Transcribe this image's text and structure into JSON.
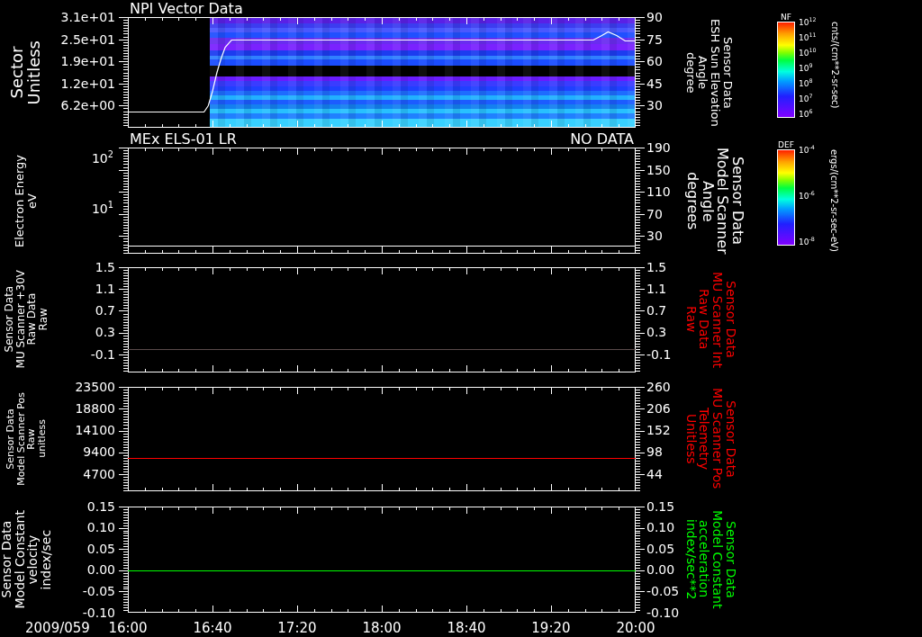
{
  "panels": [
    {
      "title": "NPI Vector Data",
      "left_label": [
        "Sector",
        "Unitless"
      ],
      "left_ticks": [
        "3.1e+01",
        "2.5e+01",
        "1.9e+01",
        "1.2e+01",
        "6.2e+00"
      ],
      "right_label": {
        "lines": [
          "Sensor Data",
          "ESH Sun Elevation",
          "Angle",
          "degree"
        ],
        "color": "#ffffff"
      },
      "spectrogram": true,
      "colorbar": {
        "title": "NF",
        "ticks": [
          "10$^{12}$",
          "10$^{11}$",
          "10$^{10}$",
          "10$^{9}$",
          "10$^{8}$",
          "10$^{7}$",
          "10$^{6}$"
        ],
        "unit": "cnts/(cm**2-sr-sec)"
      },
      "chart_data": {
        "type": "line",
        "xlim": [
          16,
          20
        ],
        "ylim": [
          15,
          90
        ],
        "yticks": [
          {
            "value": 90,
            "label": "90"
          },
          {
            "value": 75,
            "label": "75"
          },
          {
            "value": 60,
            "label": "60"
          },
          {
            "value": 45,
            "label": "45"
          },
          {
            "value": 30,
            "label": "30"
          }
        ],
        "x": [
          16,
          16.6,
          16.633,
          16.667,
          16.7,
          16.733,
          16.767,
          16.817,
          19.667,
          19.733,
          19.783,
          19.85,
          19.917,
          20
        ],
        "series": [
          {
            "color": "#ffffff",
            "values": [
              26,
              26,
              30,
              40,
              52,
              62,
              70,
              75,
              75,
              78,
              80,
              78,
              74,
              74
            ]
          }
        ]
      }
    },
    {
      "title": "MEx ELS-01 LR",
      "status": "NO DATA",
      "left_label": [
        "Electron Energy",
        "eV"
      ],
      "left_ticks": [
        "10$^{2}$",
        "10$^{1}$"
      ],
      "right_label": {
        "lines": [
          "Sensor Data",
          "Model Scanner",
          "Angle",
          "degrees"
        ],
        "color": "#ffffff"
      },
      "colorbar": {
        "title": "DEF",
        "ticks": [
          "10$^{-4}$",
          "10$^{-6}$",
          "10$^{-8}$"
        ],
        "unit": "ergs/(cm**2-sr-sec-eV)"
      },
      "chart_data": {
        "type": "line",
        "xlim": [
          16,
          20
        ],
        "ylim": [
          -2,
          190
        ],
        "yticks": [
          {
            "value": 190,
            "label": "190"
          },
          {
            "value": 150,
            "label": "150"
          },
          {
            "value": 110,
            "label": "110"
          },
          {
            "value": 70,
            "label": "70"
          },
          {
            "value": 30,
            "label": "30"
          }
        ],
        "x": [
          16,
          20
        ],
        "series": [
          {
            "color": "#ffffff",
            "values": [
              12,
              12
            ]
          }
        ]
      }
    },
    {
      "left_label": [
        "Sensor Data",
        "MU Scanner +30V",
        "Raw Data",
        "Raw"
      ],
      "left_ticks": [
        "1.5",
        "1.1",
        "0.7",
        "0.3",
        "-0.1"
      ],
      "right_label": {
        "lines": [
          "Sensor Data",
          "MU Scanner Int",
          "Raw Data",
          "Raw"
        ],
        "color": "#ff0000"
      },
      "chart_data": {
        "type": "line",
        "xlim": [
          16,
          20
        ],
        "ylim": [
          -0.43,
          1.5
        ],
        "yticks": [
          {
            "value": 1.5,
            "label": "1.5"
          },
          {
            "value": 1.1,
            "label": "1.1"
          },
          {
            "value": 0.7,
            "label": "0.7"
          },
          {
            "value": 0.3,
            "label": "0.3"
          },
          {
            "value": -0.1,
            "label": "-0.1"
          }
        ],
        "x": [
          16,
          20
        ],
        "series": [
          {
            "color": "#5a4a4a",
            "values": [
              0,
              0
            ]
          }
        ]
      }
    },
    {
      "left_label": [
        "Sensor Data",
        "Model Scanner Pos",
        "Raw",
        "unitless"
      ],
      "left_ticks": [
        "23500",
        "18800",
        "14100",
        "9400",
        "4700"
      ],
      "right_label": {
        "lines": [
          "Sensor Data",
          "MU Scanner Pos",
          "Telemetry",
          "Unitless"
        ],
        "color": "#ff0000"
      },
      "chart_data": {
        "type": "line",
        "xlim": [
          16,
          20
        ],
        "ylim": [
          2,
          260
        ],
        "yticks": [
          {
            "value": 260,
            "label": "260"
          },
          {
            "value": 206,
            "label": "206"
          },
          {
            "value": 152,
            "label": "152"
          },
          {
            "value": 98,
            "label": "98"
          },
          {
            "value": 44,
            "label": "44"
          }
        ],
        "x": [
          16,
          20
        ],
        "series": [
          {
            "color": "#ff0000",
            "values": [
              85,
              85
            ]
          }
        ]
      }
    },
    {
      "left_label": [
        "Sensor Data",
        "Model Constant",
        "velocity",
        "index/sec"
      ],
      "left_ticks": [
        "0.15",
        "0.10",
        "0.05",
        "0.00",
        "-0.05",
        "-0.10"
      ],
      "right_label": {
        "lines": [
          "Sensor Data",
          "Model Constant",
          "acceleration",
          "index/sec**2"
        ],
        "color": "#00ff00"
      },
      "chart_data": {
        "type": "line",
        "xlim": [
          16,
          20
        ],
        "ylim": [
          -0.1,
          0.15
        ],
        "yticks": [
          {
            "value": 0.15,
            "label": "0.15"
          },
          {
            "value": 0.1,
            "label": "0.10"
          },
          {
            "value": 0.05,
            "label": "0.05"
          },
          {
            "value": 0,
            "label": "0.00"
          },
          {
            "value": -0.05,
            "label": "-0.05"
          },
          {
            "value": -0.1,
            "label": "-0.10"
          }
        ],
        "xticks": [
          {
            "value": 16,
            "label": "16:00"
          },
          {
            "value": 16.667,
            "label": "16:40"
          },
          {
            "value": 17.333,
            "label": "17:20"
          },
          {
            "value": 18,
            "label": "18:00"
          },
          {
            "value": 18.667,
            "label": "18:40"
          },
          {
            "value": 19.333,
            "label": "19:20"
          },
          {
            "value": 20,
            "label": "20:00"
          }
        ],
        "x": [
          16,
          20
        ],
        "series": [
          {
            "color": "#00ff00",
            "values": [
              0,
              0
            ]
          }
        ]
      }
    }
  ],
  "x_axis": {
    "date": "2009/059"
  }
}
